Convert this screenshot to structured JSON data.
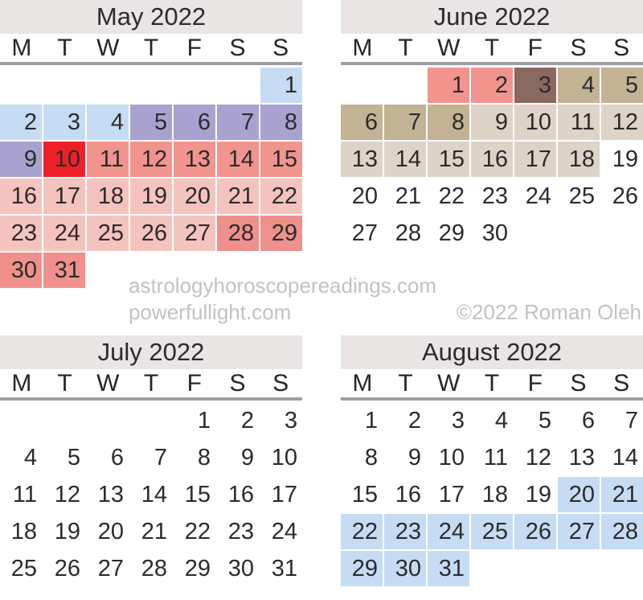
{
  "palette": {
    "title_bar_bg": "#e9e5e4",
    "weekday_rule": "#9d9da3",
    "text": "#2b2b2b",
    "watermark_text": "#c2c2c6",
    "page_bg": "#ffffff",
    "swatches": {
      "none": "transparent",
      "blue_light": "#c6dcf5",
      "purple": "#a9a2d1",
      "red_bright": "#ee2027",
      "salmon": "#f2948e",
      "pink_pale": "#f5c3bd",
      "salmon_mid": "#ef908c",
      "brown_dark": "#8a6a60",
      "tan_mid": "#c3b394",
      "beige_light": "#ded3c7"
    }
  },
  "watermark": {
    "line1": "astrologyhoroscopereadings.com",
    "line2": "powerfullight.com",
    "copyright": "©2022 Roman Oleh"
  },
  "weekday_labels": [
    "M",
    "T",
    "W",
    "T",
    "F",
    "S",
    "S"
  ],
  "months": [
    {
      "position": "tl",
      "title": "May 2022",
      "weeks": [
        [
          {
            "label": "",
            "fill": "none"
          },
          {
            "label": "",
            "fill": "none"
          },
          {
            "label": "",
            "fill": "none"
          },
          {
            "label": "",
            "fill": "none"
          },
          {
            "label": "",
            "fill": "none"
          },
          {
            "label": "",
            "fill": "none"
          },
          {
            "label": "1",
            "fill": "blue_light"
          }
        ],
        [
          {
            "label": "2",
            "fill": "blue_light"
          },
          {
            "label": "3",
            "fill": "blue_light"
          },
          {
            "label": "4",
            "fill": "blue_light"
          },
          {
            "label": "5",
            "fill": "purple"
          },
          {
            "label": "6",
            "fill": "purple"
          },
          {
            "label": "7",
            "fill": "purple"
          },
          {
            "label": "8",
            "fill": "purple"
          }
        ],
        [
          {
            "label": "9",
            "fill": "purple"
          },
          {
            "label": "10",
            "fill": "red_bright"
          },
          {
            "label": "11",
            "fill": "salmon"
          },
          {
            "label": "12",
            "fill": "salmon"
          },
          {
            "label": "13",
            "fill": "salmon"
          },
          {
            "label": "14",
            "fill": "salmon"
          },
          {
            "label": "15",
            "fill": "salmon"
          }
        ],
        [
          {
            "label": "16",
            "fill": "pink_pale"
          },
          {
            "label": "17",
            "fill": "pink_pale"
          },
          {
            "label": "18",
            "fill": "pink_pale"
          },
          {
            "label": "19",
            "fill": "pink_pale"
          },
          {
            "label": "20",
            "fill": "pink_pale"
          },
          {
            "label": "21",
            "fill": "pink_pale"
          },
          {
            "label": "22",
            "fill": "pink_pale"
          }
        ],
        [
          {
            "label": "23",
            "fill": "pink_pale"
          },
          {
            "label": "24",
            "fill": "pink_pale"
          },
          {
            "label": "25",
            "fill": "pink_pale"
          },
          {
            "label": "26",
            "fill": "pink_pale"
          },
          {
            "label": "27",
            "fill": "pink_pale"
          },
          {
            "label": "28",
            "fill": "salmon_mid"
          },
          {
            "label": "29",
            "fill": "salmon_mid"
          }
        ],
        [
          {
            "label": "30",
            "fill": "salmon_mid"
          },
          {
            "label": "31",
            "fill": "salmon_mid"
          },
          {
            "label": "",
            "fill": "none"
          },
          {
            "label": "",
            "fill": "none"
          },
          {
            "label": "",
            "fill": "none"
          },
          {
            "label": "",
            "fill": "none"
          },
          {
            "label": "",
            "fill": "none"
          }
        ]
      ]
    },
    {
      "position": "tr",
      "title": "June 2022",
      "weeks": [
        [
          {
            "label": "",
            "fill": "none"
          },
          {
            "label": "",
            "fill": "none"
          },
          {
            "label": "1",
            "fill": "salmon"
          },
          {
            "label": "2",
            "fill": "salmon"
          },
          {
            "label": "3",
            "fill": "brown_dark"
          },
          {
            "label": "4",
            "fill": "tan_mid"
          },
          {
            "label": "5",
            "fill": "tan_mid"
          }
        ],
        [
          {
            "label": "6",
            "fill": "tan_mid"
          },
          {
            "label": "7",
            "fill": "tan_mid"
          },
          {
            "label": "8",
            "fill": "tan_mid"
          },
          {
            "label": "9",
            "fill": "beige_light"
          },
          {
            "label": "10",
            "fill": "beige_light"
          },
          {
            "label": "11",
            "fill": "beige_light"
          },
          {
            "label": "12",
            "fill": "beige_light"
          }
        ],
        [
          {
            "label": "13",
            "fill": "beige_light"
          },
          {
            "label": "14",
            "fill": "beige_light"
          },
          {
            "label": "15",
            "fill": "beige_light"
          },
          {
            "label": "16",
            "fill": "beige_light"
          },
          {
            "label": "17",
            "fill": "beige_light"
          },
          {
            "label": "18",
            "fill": "beige_light"
          },
          {
            "label": "19",
            "fill": "none"
          }
        ],
        [
          {
            "label": "20",
            "fill": "none"
          },
          {
            "label": "21",
            "fill": "none"
          },
          {
            "label": "22",
            "fill": "none"
          },
          {
            "label": "23",
            "fill": "none"
          },
          {
            "label": "24",
            "fill": "none"
          },
          {
            "label": "25",
            "fill": "none"
          },
          {
            "label": "26",
            "fill": "none"
          }
        ],
        [
          {
            "label": "27",
            "fill": "none"
          },
          {
            "label": "28",
            "fill": "none"
          },
          {
            "label": "29",
            "fill": "none"
          },
          {
            "label": "30",
            "fill": "none"
          },
          {
            "label": "",
            "fill": "none"
          },
          {
            "label": "",
            "fill": "none"
          },
          {
            "label": "",
            "fill": "none"
          }
        ]
      ]
    },
    {
      "position": "bl",
      "title": "July 2022",
      "weeks": [
        [
          {
            "label": "",
            "fill": "none"
          },
          {
            "label": "",
            "fill": "none"
          },
          {
            "label": "",
            "fill": "none"
          },
          {
            "label": "",
            "fill": "none"
          },
          {
            "label": "1",
            "fill": "none"
          },
          {
            "label": "2",
            "fill": "none"
          },
          {
            "label": "3",
            "fill": "none"
          }
        ],
        [
          {
            "label": "4",
            "fill": "none"
          },
          {
            "label": "5",
            "fill": "none"
          },
          {
            "label": "6",
            "fill": "none"
          },
          {
            "label": "7",
            "fill": "none"
          },
          {
            "label": "8",
            "fill": "none"
          },
          {
            "label": "9",
            "fill": "none"
          },
          {
            "label": "10",
            "fill": "none"
          }
        ],
        [
          {
            "label": "11",
            "fill": "none"
          },
          {
            "label": "12",
            "fill": "none"
          },
          {
            "label": "13",
            "fill": "none"
          },
          {
            "label": "14",
            "fill": "none"
          },
          {
            "label": "15",
            "fill": "none"
          },
          {
            "label": "16",
            "fill": "none"
          },
          {
            "label": "17",
            "fill": "none"
          }
        ],
        [
          {
            "label": "18",
            "fill": "none"
          },
          {
            "label": "19",
            "fill": "none"
          },
          {
            "label": "20",
            "fill": "none"
          },
          {
            "label": "21",
            "fill": "none"
          },
          {
            "label": "22",
            "fill": "none"
          },
          {
            "label": "23",
            "fill": "none"
          },
          {
            "label": "24",
            "fill": "none"
          }
        ],
        [
          {
            "label": "25",
            "fill": "none"
          },
          {
            "label": "26",
            "fill": "none"
          },
          {
            "label": "27",
            "fill": "none"
          },
          {
            "label": "28",
            "fill": "none"
          },
          {
            "label": "29",
            "fill": "none"
          },
          {
            "label": "30",
            "fill": "none"
          },
          {
            "label": "31",
            "fill": "none"
          }
        ]
      ]
    },
    {
      "position": "br",
      "title": "August 2022",
      "weeks": [
        [
          {
            "label": "1",
            "fill": "none"
          },
          {
            "label": "2",
            "fill": "none"
          },
          {
            "label": "3",
            "fill": "none"
          },
          {
            "label": "4",
            "fill": "none"
          },
          {
            "label": "5",
            "fill": "none"
          },
          {
            "label": "6",
            "fill": "none"
          },
          {
            "label": "7",
            "fill": "none"
          }
        ],
        [
          {
            "label": "8",
            "fill": "none"
          },
          {
            "label": "9",
            "fill": "none"
          },
          {
            "label": "10",
            "fill": "none"
          },
          {
            "label": "11",
            "fill": "none"
          },
          {
            "label": "12",
            "fill": "none"
          },
          {
            "label": "13",
            "fill": "none"
          },
          {
            "label": "14",
            "fill": "none"
          }
        ],
        [
          {
            "label": "15",
            "fill": "none"
          },
          {
            "label": "16",
            "fill": "none"
          },
          {
            "label": "17",
            "fill": "none"
          },
          {
            "label": "18",
            "fill": "none"
          },
          {
            "label": "19",
            "fill": "none"
          },
          {
            "label": "20",
            "fill": "blue_light"
          },
          {
            "label": "21",
            "fill": "blue_light"
          }
        ],
        [
          {
            "label": "22",
            "fill": "blue_light"
          },
          {
            "label": "23",
            "fill": "blue_light"
          },
          {
            "label": "24",
            "fill": "blue_light"
          },
          {
            "label": "25",
            "fill": "blue_light"
          },
          {
            "label": "26",
            "fill": "blue_light"
          },
          {
            "label": "27",
            "fill": "blue_light"
          },
          {
            "label": "28",
            "fill": "blue_light"
          }
        ],
        [
          {
            "label": "29",
            "fill": "blue_light"
          },
          {
            "label": "30",
            "fill": "blue_light"
          },
          {
            "label": "31",
            "fill": "blue_light"
          },
          {
            "label": "",
            "fill": "none"
          },
          {
            "label": "",
            "fill": "none"
          },
          {
            "label": "",
            "fill": "none"
          },
          {
            "label": "",
            "fill": "none"
          }
        ]
      ]
    }
  ]
}
